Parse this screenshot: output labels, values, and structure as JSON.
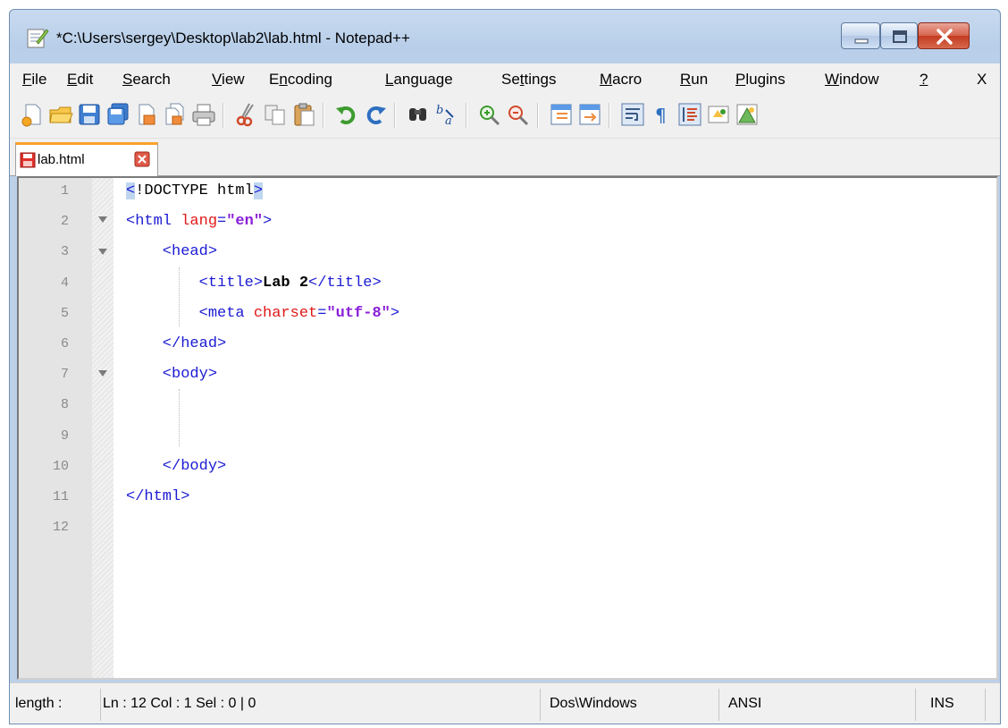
{
  "window": {
    "title": "*C:\\Users\\sergey\\Desktop\\lab2\\lab.html - Notepad++"
  },
  "menu": {
    "file": {
      "ul": "F",
      "rest": "ile"
    },
    "edit": {
      "ul": "E",
      "rest": "dit"
    },
    "search": {
      "ul": "S",
      "rest": "earch"
    },
    "view": {
      "ul": "V",
      "rest": "iew"
    },
    "encoding": {
      "pre": "E",
      "ul": "n",
      "rest": "coding"
    },
    "language": {
      "ul": "L",
      "rest": "anguage"
    },
    "settings": {
      "pre": "Se",
      "ul": "t",
      "rest": "tings"
    },
    "macro": {
      "ul": "M",
      "rest": "acro"
    },
    "run": {
      "ul": "R",
      "rest": "un"
    },
    "plugins": {
      "ul": "P",
      "rest": "lugins"
    },
    "window": {
      "ul": "W",
      "rest": "indow"
    },
    "help": {
      "ul": "?",
      "rest": ""
    },
    "close_doc": "X"
  },
  "toolbar": {
    "icons": [
      "new-file-icon",
      "open-file-icon",
      "save-icon",
      "save-all-icon",
      "close-icon",
      "close-all-icon",
      "print-icon",
      "cut-icon",
      "copy-icon",
      "paste-icon",
      "undo-icon",
      "redo-icon",
      "find-icon",
      "replace-icon",
      "zoom-in-icon",
      "zoom-out-icon",
      "sync-vertical-icon",
      "sync-horizontal-icon",
      "word-wrap-icon",
      "show-all-characters-icon",
      "indent-guide-icon",
      "macro-record-icon",
      "macro-playback-icon"
    ]
  },
  "tabs": [
    {
      "label": "lab.html",
      "modified": true
    }
  ],
  "editor": {
    "line_numbers": [
      "1",
      "2",
      "3",
      "4",
      "5",
      "6",
      "7",
      "8",
      "9",
      "10",
      "11",
      "12"
    ],
    "lines": [
      {
        "tokens": [
          {
            "t": "<",
            "c": "tag hl"
          },
          {
            "t": "!DOCTYPE html",
            "c": "doctype"
          },
          {
            "t": ">",
            "c": "tag hl"
          }
        ]
      },
      {
        "tokens": [
          {
            "t": "<html ",
            "c": "tag"
          },
          {
            "t": "lang",
            "c": "attr"
          },
          {
            "t": "=",
            "c": "tag"
          },
          {
            "t": "\"en\"",
            "c": "val"
          },
          {
            "t": ">",
            "c": "tag"
          }
        ]
      },
      {
        "tokens": [
          {
            "t": "    <head>",
            "c": "tag"
          }
        ]
      },
      {
        "tokens": [
          {
            "t": "        <title>",
            "c": "tag"
          },
          {
            "t": "Lab 2",
            "c": "txt"
          },
          {
            "t": "</title>",
            "c": "tag"
          }
        ]
      },
      {
        "tokens": [
          {
            "t": "        <meta ",
            "c": "tag"
          },
          {
            "t": "charset",
            "c": "attr"
          },
          {
            "t": "=",
            "c": "tag"
          },
          {
            "t": "\"utf-8\"",
            "c": "val"
          },
          {
            "t": ">",
            "c": "tag"
          }
        ]
      },
      {
        "tokens": [
          {
            "t": "    </head>",
            "c": "tag"
          }
        ]
      },
      {
        "tokens": [
          {
            "t": "    <body>",
            "c": "tag"
          }
        ]
      },
      {
        "tokens": []
      },
      {
        "tokens": []
      },
      {
        "tokens": [
          {
            "t": "    </body>",
            "c": "tag"
          }
        ]
      },
      {
        "tokens": [
          {
            "t": "</html>",
            "c": "tag"
          }
        ]
      },
      {
        "tokens": []
      }
    ]
  },
  "statusbar": {
    "length": "length :",
    "position": "Ln : 12    Col : 1    Sel : 0 | 0",
    "eol": "Dos\\Windows",
    "encoding": "ANSI",
    "mode": "INS"
  },
  "colors": {
    "tag": "#1b1bd3",
    "attr": "#e01818",
    "value": "#8a1fd8",
    "tab_accent": "#f9a22a",
    "close_button": "#c23a20"
  }
}
